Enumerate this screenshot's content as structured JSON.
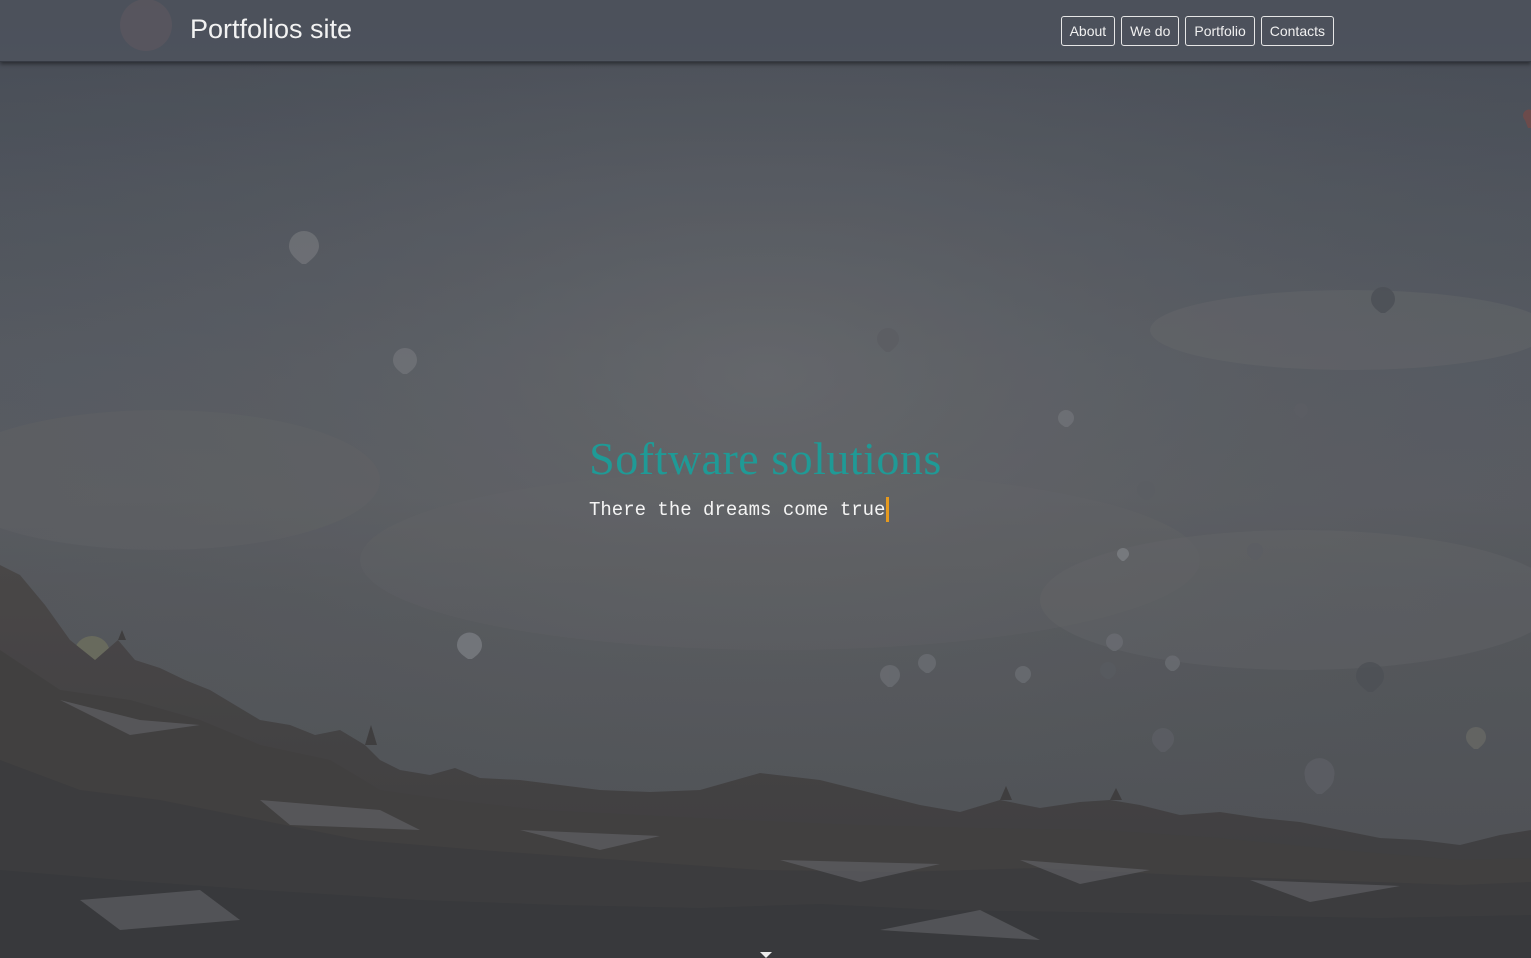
{
  "header": {
    "brand": "Portfolios site",
    "nav": [
      {
        "label": "About"
      },
      {
        "label": "We do"
      },
      {
        "label": "Portfolio"
      },
      {
        "label": "Contacts"
      }
    ]
  },
  "hero": {
    "title": "Software solutions",
    "subtitle": "There the dreams come true"
  },
  "colors": {
    "title": "#1f9a96",
    "cursor": "#e69a1e",
    "overlay": "#50565f"
  }
}
